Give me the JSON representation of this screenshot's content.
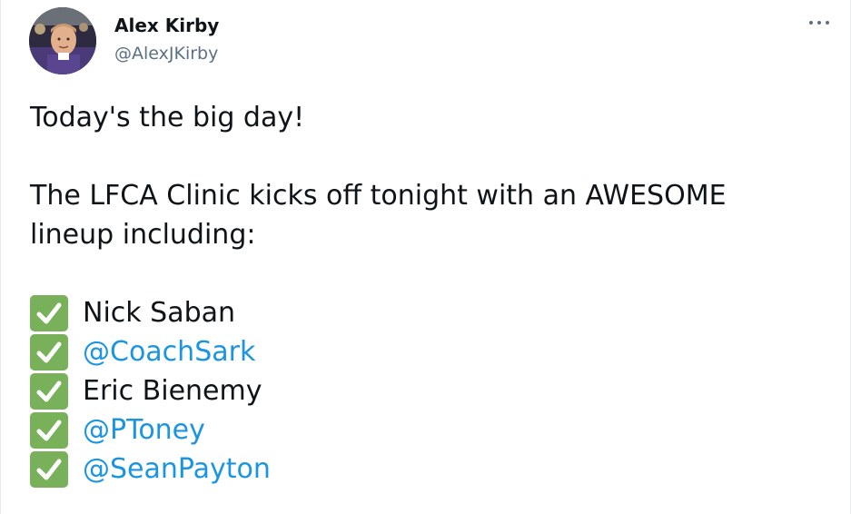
{
  "tweet": {
    "author_name": "Alex Kirby",
    "author_handle": "@AlexJKirby",
    "lines": [
      "Today's the big day!",
      "The LFCA Clinic kicks off tonight with an AWESOME",
      "lineup including:"
    ],
    "lineup": [
      {
        "text": "Nick Saban",
        "is_mention": false
      },
      {
        "text": "@CoachSark",
        "is_mention": true
      },
      {
        "text": "Eric Bienemy",
        "is_mention": false
      },
      {
        "text": "@PToney",
        "is_mention": true
      },
      {
        "text": "@SeanPayton",
        "is_mention": true
      }
    ]
  },
  "icons": {
    "more": "more-options-icon",
    "check": "check-mark-button-emoji"
  },
  "colors": {
    "mention": "#1b95e0",
    "text": "#0f1419",
    "secondary": "#5b7083",
    "check_bg": "#78b159"
  }
}
